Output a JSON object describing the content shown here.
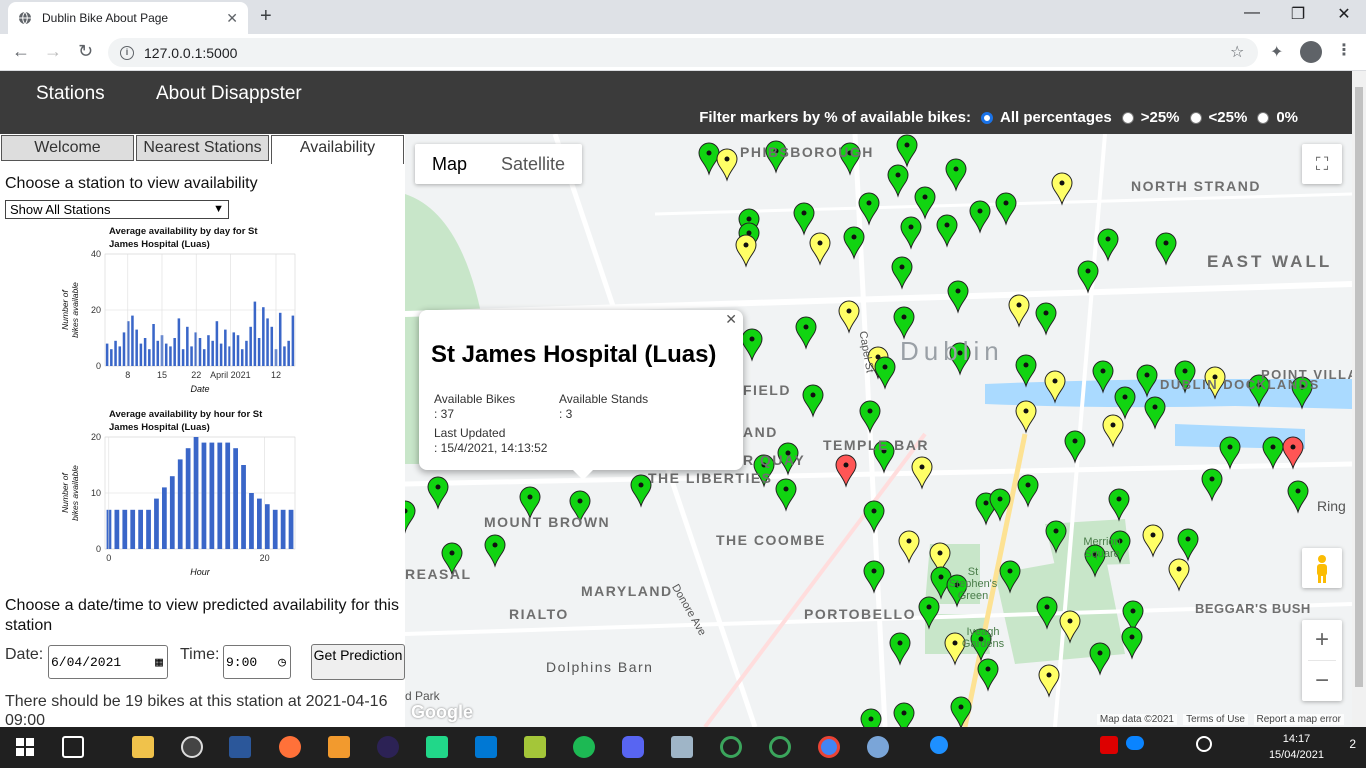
{
  "browser": {
    "tab_title": "Dublin Bike About Page",
    "url": "127.0.0.1:5000"
  },
  "header": {
    "nav_stations": "Stations",
    "nav_about": "About Disappster",
    "filter_label": "Filter markers by % of available bikes:",
    "filter_options": [
      "All percentages",
      ">25%",
      "<25%",
      "0%"
    ],
    "filter_selected": "All percentages"
  },
  "sidebar": {
    "tabs": [
      "Welcome",
      "Nearest Stations",
      "Availability"
    ],
    "active_tab": "Availability",
    "heading": "Choose a station to view availability",
    "select_value": "Show All Stations",
    "predict_heading": "Choose a date/time to view predicted availability for this station",
    "date_label": "Date:",
    "date_value": "6/04/2021",
    "time_label": "Time:",
    "time_value": "9:00",
    "predict_button": "Get Prediction",
    "result": "There should be 19 bikes at this station at 2021-04-16 09:00"
  },
  "chart_data": [
    {
      "type": "bar",
      "title": "Average availability by day for St James Hospital (Luas)",
      "xlabel": "Date",
      "ylabel": "Number of bikes available",
      "ylim": [
        0,
        40
      ],
      "yticks": [
        0,
        20,
        40
      ],
      "xticks": [
        "8",
        "15",
        "22",
        "April 2021",
        "12"
      ],
      "values": [
        8,
        6,
        9,
        7,
        12,
        16,
        18,
        13,
        8,
        10,
        6,
        15,
        9,
        11,
        8,
        7,
        10,
        17,
        6,
        14,
        7,
        12,
        10,
        6,
        11,
        9,
        16,
        8,
        13,
        7,
        12,
        11,
        6,
        9,
        14,
        23,
        10,
        21,
        17,
        14,
        6,
        19,
        7,
        9,
        18
      ]
    },
    {
      "type": "bar",
      "title": "Average availability by hour for St James Hospital (Luas)",
      "xlabel": "Hour",
      "ylabel": "Number of bikes available",
      "ylim": [
        0,
        20
      ],
      "yticks": [
        0,
        10,
        20
      ],
      "xticks": [
        "0",
        "20"
      ],
      "categories": [
        0,
        1,
        2,
        3,
        4,
        5,
        6,
        7,
        8,
        9,
        10,
        11,
        12,
        13,
        14,
        15,
        16,
        17,
        18,
        19,
        20,
        21,
        22,
        23
      ],
      "values": [
        7,
        7,
        7,
        7,
        7,
        7,
        9,
        11,
        13,
        16,
        18,
        20,
        19,
        19,
        19,
        19,
        18,
        15,
        10,
        9,
        8,
        7,
        7,
        7
      ]
    }
  ],
  "map": {
    "type_map": "Map",
    "type_satellite": "Satellite",
    "infowindow": {
      "title": "St James Hospital (Luas)",
      "bikes_label": "Available Bikes",
      "bikes_value": ": 37",
      "stands_label": "Available Stands",
      "stands_value": ": 3",
      "updated_label": "Last Updated",
      "updated_value": ": 15/4/2021, 14:13:52"
    },
    "labels": [
      "PHIBSBOROUGH",
      "NORTH STRAND",
      "EAST WALL",
      "Dublin",
      "TEMPLE BAR",
      "THE LIBERTIES",
      "MOUNT BROWN",
      "THE COOMBE",
      "MARYLAND",
      "PORTOBELLO",
      "RIALTO",
      "Dolphins Barn",
      "BEGGAR'S BUSH",
      "DUBLIN DOCKLANDS",
      "POINT VILLA",
      "Capel St",
      "Donore Ave",
      "Merrion Square",
      "St Stephen's Green",
      "Iveagh Gardens",
      "Ring",
      "FIELD",
      "AND",
      "R QUAY",
      "REASAL",
      "d Park"
    ],
    "attribution": "Map data ©2021",
    "terms": "Terms of Use",
    "report": "Report a map error",
    "brand": "Google",
    "marker_colors": {
      "green": "#11d411",
      "yellow": "#ffff66",
      "red": "#ff5555"
    }
  },
  "taskbar": {
    "time": "14:17",
    "date": "15/04/2021",
    "notifications": "2"
  }
}
